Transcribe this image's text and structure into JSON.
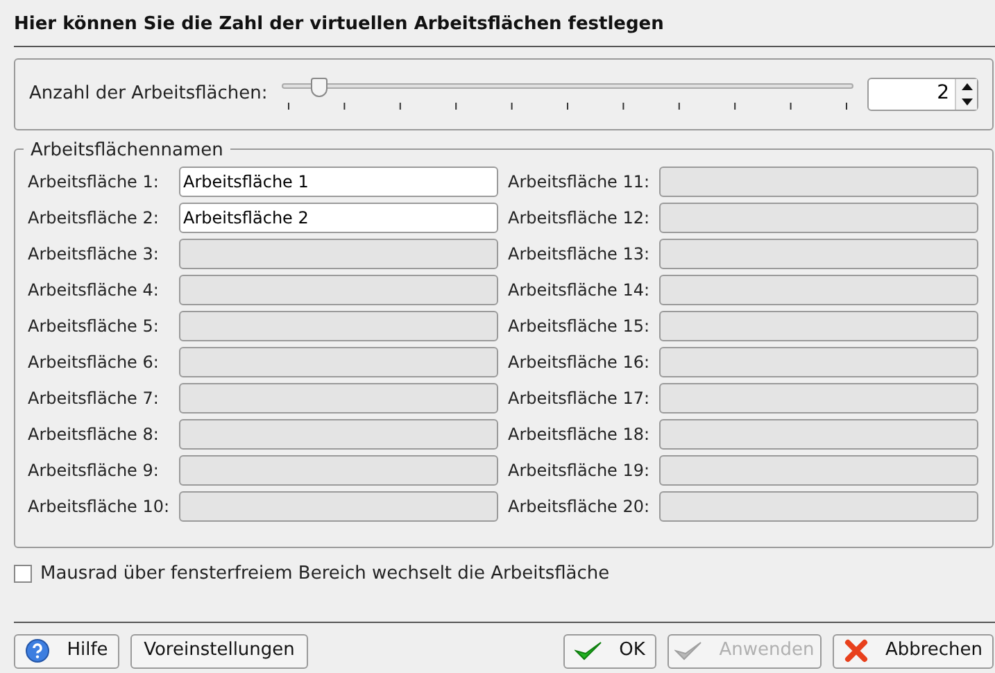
{
  "heading": "Hier können Sie die Zahl der virtuellen Arbeitsflächen festlegen",
  "count": {
    "label": "Anzahl der Arbeitsflächen:",
    "level": 0.053,
    "value": "2"
  },
  "names": {
    "title": "Arbeitsflächennamen",
    "fields": [
      {
        "label": "Arbeitsfläche 1:",
        "value": "Arbeitsfläche 1",
        "disabled": false
      },
      {
        "label": "Arbeitsfläche 2:",
        "value": "Arbeitsfläche 2",
        "disabled": false
      },
      {
        "label": "Arbeitsfläche 3:",
        "disabled": true
      },
      {
        "label": "Arbeitsfläche 4:",
        "disabled": true
      },
      {
        "label": "Arbeitsfläche 5:",
        "disabled": true
      },
      {
        "label": "Arbeitsfläche 6:",
        "disabled": true
      },
      {
        "label": "Arbeitsfläche 7:",
        "disabled": true
      },
      {
        "label": "Arbeitsfläche 8:",
        "disabled": true
      },
      {
        "label": "Arbeitsfläche 9:",
        "disabled": true
      },
      {
        "label": "Arbeitsfläche 10:",
        "disabled": true
      },
      {
        "label": "Arbeitsfläche 11:",
        "disabled": true
      },
      {
        "label": "Arbeitsfläche 12:",
        "disabled": true
      },
      {
        "label": "Arbeitsfläche 13:",
        "disabled": true
      },
      {
        "label": "Arbeitsfläche 14:",
        "disabled": true
      },
      {
        "label": "Arbeitsfläche 15:",
        "disabled": true
      },
      {
        "label": "Arbeitsfläche 16:",
        "disabled": true
      },
      {
        "label": "Arbeitsfläche 17:",
        "disabled": true
      },
      {
        "label": "Arbeitsfläche 18:",
        "disabled": true
      },
      {
        "label": "Arbeitsfläche 19:",
        "disabled": true
      },
      {
        "label": "Arbeitsfläche 20:",
        "disabled": true
      }
    ]
  },
  "mousewheel": {
    "label": "Mausrad über fensterfreiem Bereich wechselt die Arbeitsfläche",
    "checked": false
  },
  "buttons": [
    {
      "kind": "help",
      "label": "Hilfe",
      "disabled": false
    },
    {
      "kind": "plain",
      "label": "Voreinstellungen",
      "disabled": false
    },
    {
      "kind": "spacer"
    },
    {
      "kind": "ok",
      "label": "OK",
      "disabled": false
    },
    {
      "kind": "ok",
      "label": "Anwenden",
      "disabled": true
    },
    {
      "kind": "cancel",
      "label": "Abbrechen",
      "disabled": false
    }
  ]
}
